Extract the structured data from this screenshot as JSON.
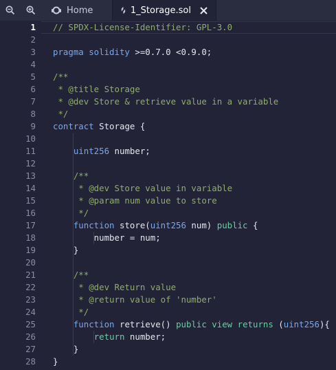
{
  "tabs": [
    {
      "label": "Home",
      "active": false
    },
    {
      "label": "1_Storage.sol",
      "active": true
    }
  ],
  "active_line": 1,
  "lines": [
    [
      {
        "t": "// SPDX-License-Identifier: GPL-3.0",
        "c": "comment"
      }
    ],
    [],
    [
      {
        "t": "pragma solidity ",
        "c": "kw"
      },
      {
        "t": ">=0.7.0 <0.9.0;",
        "c": "plain"
      }
    ],
    [],
    [
      {
        "t": "/**",
        "c": "comment"
      }
    ],
    [
      {
        "t": " * @title Storage",
        "c": "comment"
      }
    ],
    [
      {
        "t": " * @dev Store & retrieve value in a variable",
        "c": "comment"
      }
    ],
    [
      {
        "t": " */",
        "c": "comment"
      }
    ],
    [
      {
        "t": "contract ",
        "c": "kw"
      },
      {
        "t": "Storage {",
        "c": "plain"
      }
    ],
    [],
    [
      {
        "t": "    ",
        "c": "plain"
      },
      {
        "t": "uint256",
        "c": "kw"
      },
      {
        "t": " number;",
        "c": "plain"
      }
    ],
    [],
    [
      {
        "t": "    /**",
        "c": "comment"
      }
    ],
    [
      {
        "t": "     * @dev Store value in variable",
        "c": "comment"
      }
    ],
    [
      {
        "t": "     * @param num value to store",
        "c": "comment"
      }
    ],
    [
      {
        "t": "     */",
        "c": "comment"
      }
    ],
    [
      {
        "t": "    ",
        "c": "plain"
      },
      {
        "t": "function",
        "c": "kw"
      },
      {
        "t": " store(",
        "c": "plain"
      },
      {
        "t": "uint256",
        "c": "kw"
      },
      {
        "t": " num) ",
        "c": "plain"
      },
      {
        "t": "public",
        "c": "green"
      },
      {
        "t": " {",
        "c": "plain"
      }
    ],
    [
      {
        "t": "        number = num;",
        "c": "plain"
      }
    ],
    [
      {
        "t": "    }",
        "c": "plain"
      }
    ],
    [],
    [
      {
        "t": "    /**",
        "c": "comment"
      }
    ],
    [
      {
        "t": "     * @dev Return value",
        "c": "comment"
      }
    ],
    [
      {
        "t": "     * @return value of 'number'",
        "c": "comment"
      }
    ],
    [
      {
        "t": "     */",
        "c": "comment"
      }
    ],
    [
      {
        "t": "    ",
        "c": "plain"
      },
      {
        "t": "function",
        "c": "kw"
      },
      {
        "t": " retrieve() ",
        "c": "plain"
      },
      {
        "t": "public",
        "c": "green"
      },
      {
        "t": " ",
        "c": "plain"
      },
      {
        "t": "view",
        "c": "green"
      },
      {
        "t": " ",
        "c": "plain"
      },
      {
        "t": "returns",
        "c": "green"
      },
      {
        "t": " (",
        "c": "plain"
      },
      {
        "t": "uint256",
        "c": "kw"
      },
      {
        "t": "){",
        "c": "plain"
      }
    ],
    [
      {
        "t": "        ",
        "c": "plain"
      },
      {
        "t": "return",
        "c": "green"
      },
      {
        "t": " number;",
        "c": "plain"
      }
    ],
    [
      {
        "t": "    }",
        "c": "plain"
      }
    ],
    [
      {
        "t": "}",
        "c": "plain"
      }
    ]
  ],
  "colors": {
    "background": "#222336",
    "tabbar": "#2a2c3f",
    "comment": "#8fae6a",
    "keyword": "#76a8f0",
    "modifier": "#5fd4a0",
    "text": "#e6e6ef"
  },
  "icons": {
    "zoom_out": "zoom-out-icon",
    "zoom_in": "zoom-in-icon",
    "home": "remix-logo-icon",
    "file": "solidity-file-icon",
    "close": "close-icon"
  }
}
